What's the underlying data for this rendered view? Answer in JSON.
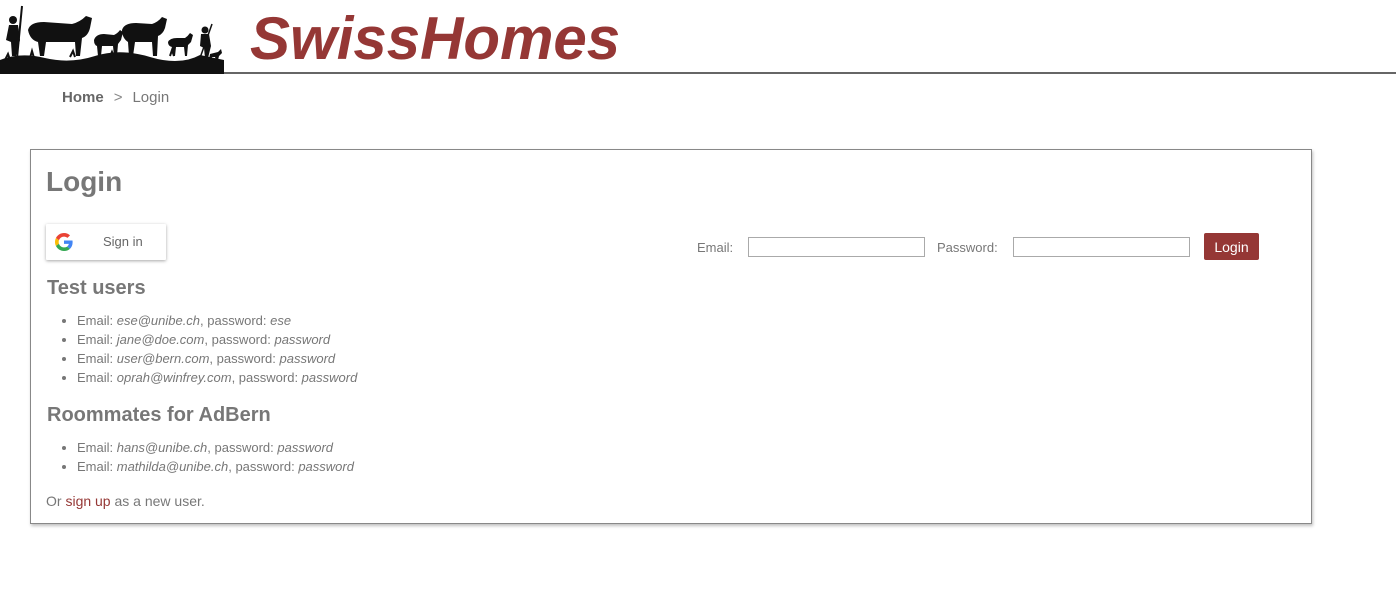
{
  "header": {
    "site_title": "SwissHomes",
    "logo": "alpine-farmers-with-cows-silhouette"
  },
  "breadcrumb": {
    "home": "Home",
    "separator": ">",
    "current": "Login"
  },
  "login": {
    "title": "Login",
    "google_signin_label": "Sign in",
    "email_label": "Email:",
    "email_value": "",
    "password_label": "Password:",
    "password_value": "",
    "submit_label": "Login"
  },
  "test_users": {
    "heading": "Test users",
    "items": [
      {
        "email_label": "Email: ",
        "email": "ese@unibe.ch",
        "password_label": ", password: ",
        "password": "ese"
      },
      {
        "email_label": "Email: ",
        "email": "jane@doe.com",
        "password_label": ", password: ",
        "password": "password"
      },
      {
        "email_label": "Email: ",
        "email": "user@bern.com",
        "password_label": ", password: ",
        "password": "password"
      },
      {
        "email_label": "Email: ",
        "email": "oprah@winfrey.com",
        "password_label": ", password: ",
        "password": "password"
      }
    ]
  },
  "roommates": {
    "heading": "Roommates for AdBern",
    "items": [
      {
        "email_label": "Email: ",
        "email": "hans@unibe.ch",
        "password_label": ", password: ",
        "password": "password"
      },
      {
        "email_label": "Email: ",
        "email": "mathilda@unibe.ch",
        "password_label": ", password: ",
        "password": "password"
      }
    ]
  },
  "signup": {
    "prefix": "Or ",
    "link_text": "sign up",
    "suffix": " as a new user."
  },
  "colors": {
    "brand": "#953735",
    "text": "#777777"
  }
}
